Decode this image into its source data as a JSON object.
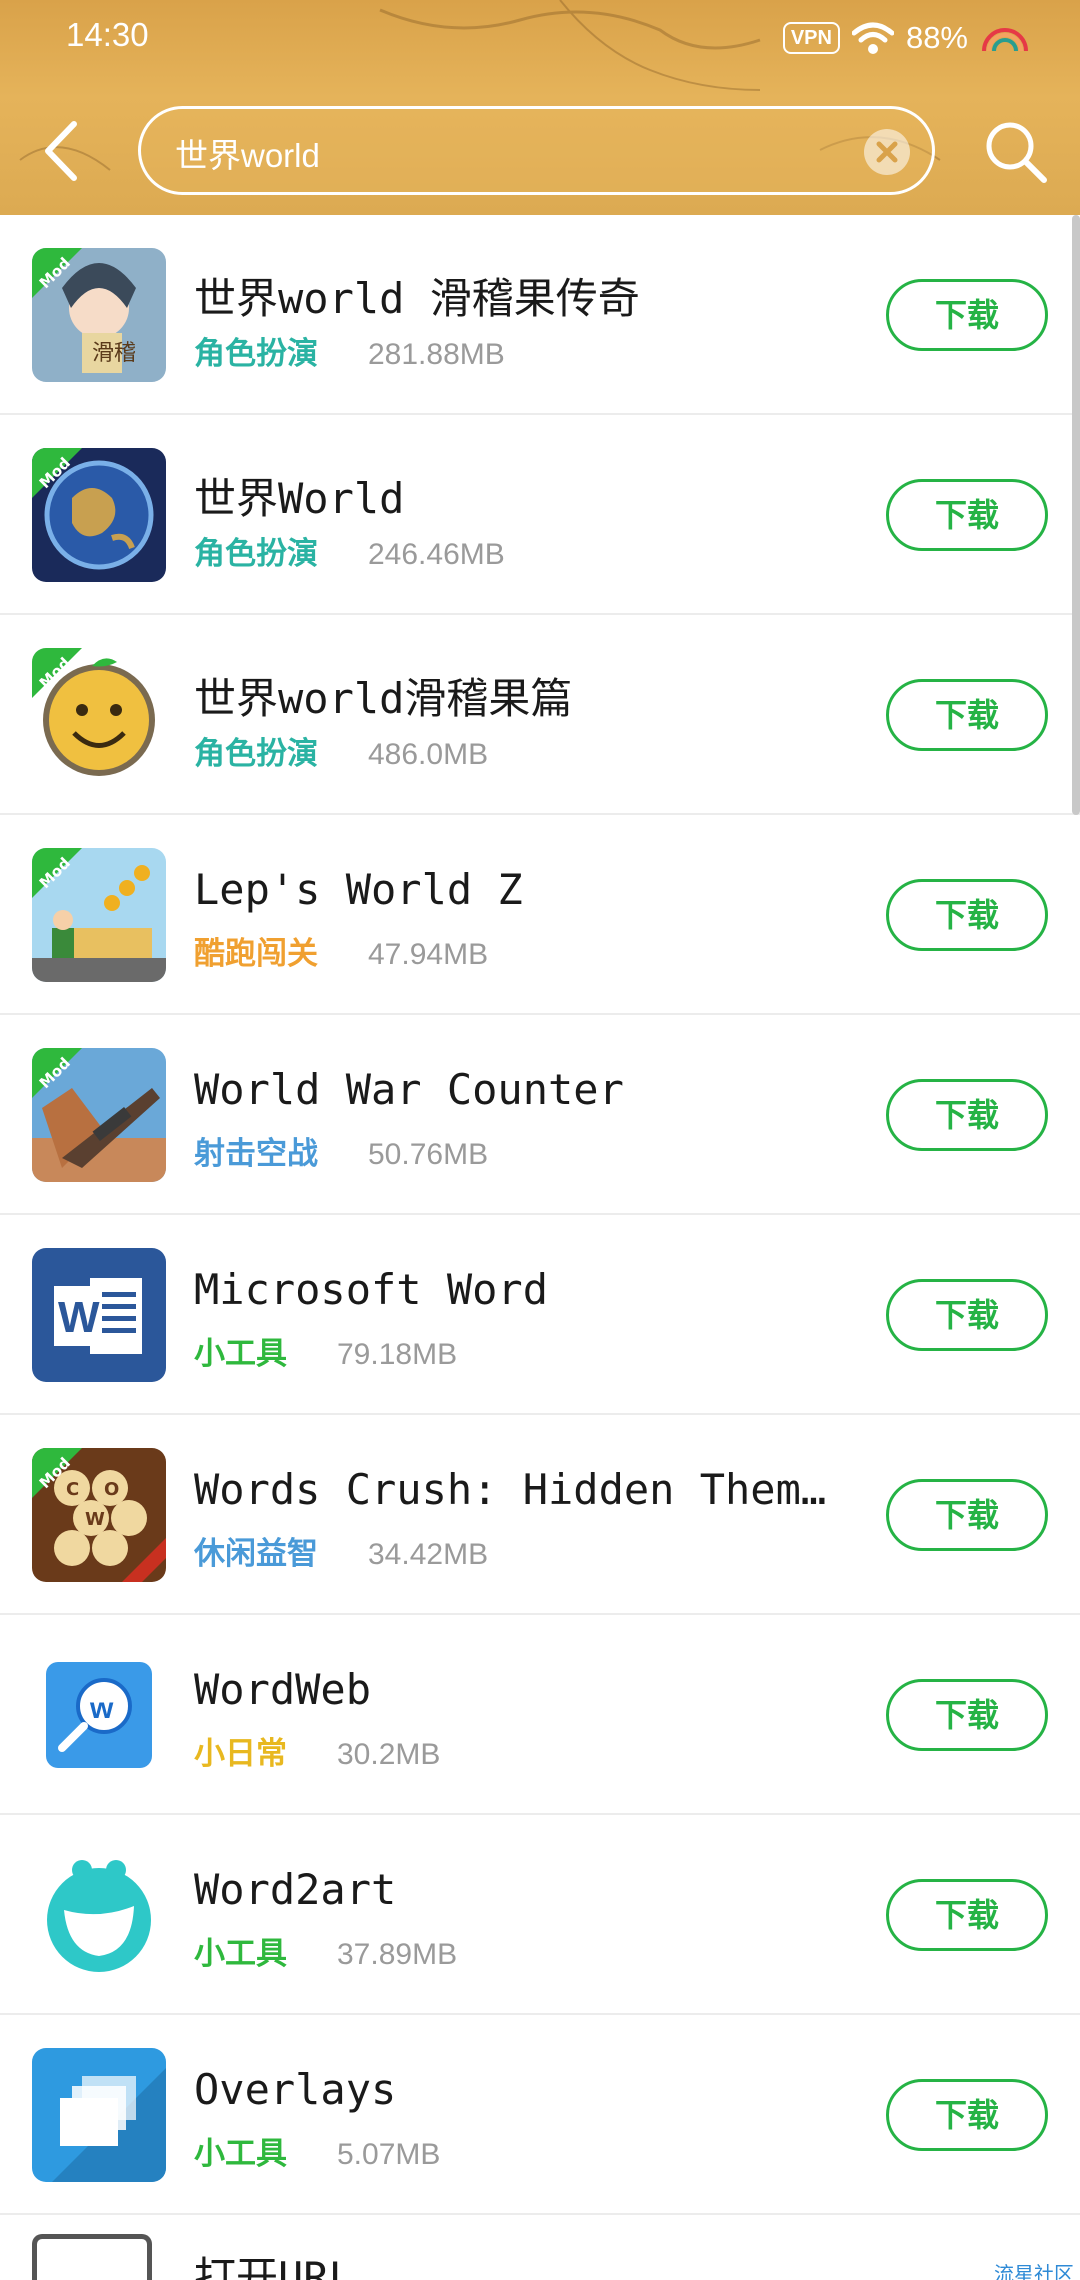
{
  "status_bar": {
    "time": "14:30",
    "vpn": "VPN",
    "battery": "88%"
  },
  "search": {
    "query": "世界world"
  },
  "download_label": "下载",
  "results": [
    {
      "name": "世界world 滑稽果传奇",
      "category": "角色扮演",
      "category_color": "#2ab3a3",
      "size": "281.88MB",
      "mod": true,
      "icon": "anime-girl-icon"
    },
    {
      "name": "世界World",
      "category": "角色扮演",
      "category_color": "#2ab3a3",
      "size": "246.46MB",
      "mod": true,
      "icon": "globe-icon"
    },
    {
      "name": "世界world滑稽果篇",
      "category": "角色扮演",
      "category_color": "#2ab3a3",
      "size": "486.0MB",
      "mod": true,
      "icon": "smiley-fruit-icon"
    },
    {
      "name": "Lep's World Z",
      "category": "酷跑闯关",
      "category_color": "#f0a030",
      "size": "47.94MB",
      "mod": true,
      "icon": "platformer-icon"
    },
    {
      "name": "World War Counter",
      "category": "射击空战",
      "category_color": "#4a9ad8",
      "size": "50.76MB",
      "mod": true,
      "icon": "gun-icon"
    },
    {
      "name": "Microsoft Word",
      "category": "小工具",
      "category_color": "#2fb83d",
      "size": "79.18MB",
      "mod": false,
      "icon": "word-icon"
    },
    {
      "name": "Words Crush: Hidden Them…",
      "category": "休闲益智",
      "category_color": "#4a9ad8",
      "size": "34.42MB",
      "mod": true,
      "icon": "words-crush-icon"
    },
    {
      "name": "WordWeb",
      "category": "小日常",
      "category_color": "#e8b820",
      "size": "30.2MB",
      "mod": false,
      "icon": "wordweb-icon"
    },
    {
      "name": "Word2art",
      "category": "小工具",
      "category_color": "#2fb83d",
      "size": "37.89MB",
      "mod": false,
      "icon": "smile-face-icon"
    },
    {
      "name": "Overlays",
      "category": "小工具",
      "category_color": "#2fb83d",
      "size": "5.07MB",
      "mod": false,
      "icon": "overlays-icon"
    }
  ],
  "partial_item": {
    "name": "打开URL",
    "watermark": "流星社区"
  }
}
